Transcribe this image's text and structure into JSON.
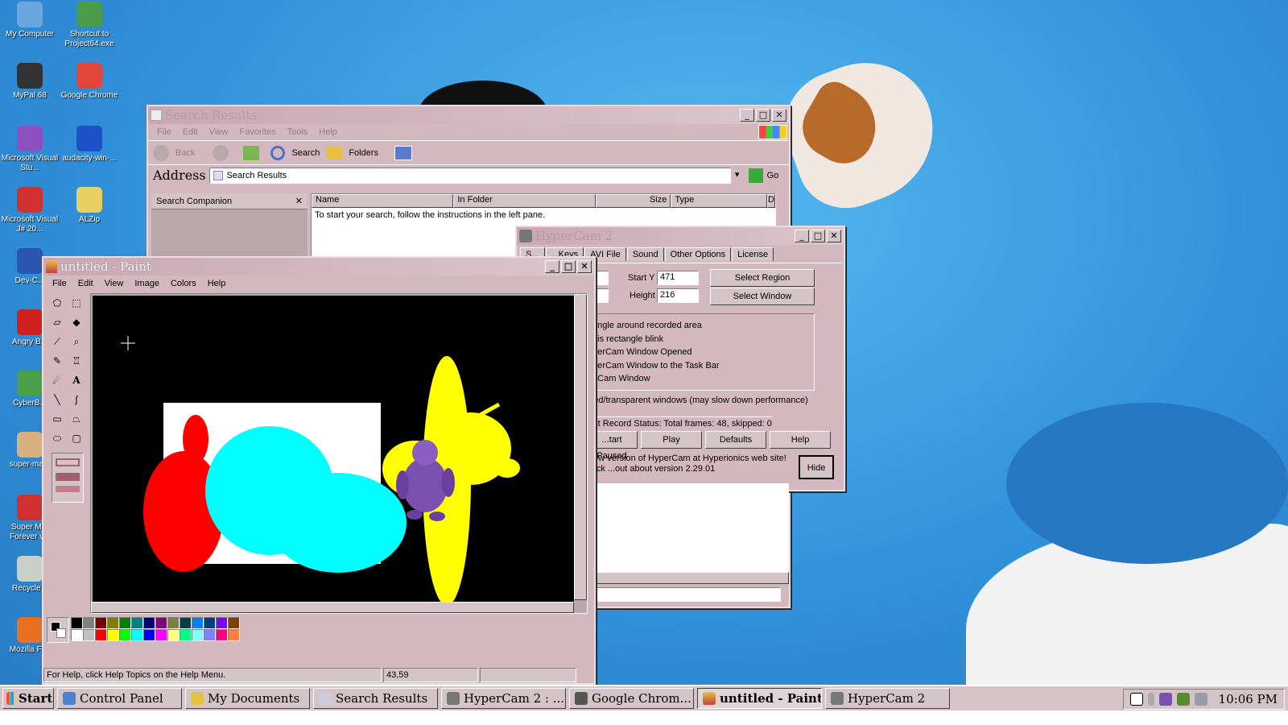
{
  "desktop": {
    "icons": [
      {
        "label": "My Computer",
        "color": "#6aa6e0"
      },
      {
        "label": "Shortcut to Project64.exe",
        "color": "#4b9b4b"
      },
      {
        "label": "MyPal 68",
        "color": "#333333"
      },
      {
        "label": "Google Chrome",
        "color": "#e0473a"
      },
      {
        "label": "Microsoft Visual Stu...",
        "color": "#8c4fc0"
      },
      {
        "label": "audacity-win-...",
        "color": "#1e50c8"
      },
      {
        "label": "Microsoft Visual J# 20...",
        "color": "#d03030"
      },
      {
        "label": "ALZip",
        "color": "#e8d060"
      },
      {
        "label": "Dev-C...",
        "color": "#2a56b0"
      },
      {
        "label": "Angry B...",
        "color": "#d02020"
      },
      {
        "label": "CyberB...",
        "color": "#48a048"
      },
      {
        "label": "super-ma...",
        "color": "#d8b080"
      },
      {
        "label": "Super M... Forever v...",
        "color": "#d03030"
      },
      {
        "label": "Recycle...",
        "color": "#c8d0c8"
      },
      {
        "label": "Mozilla Fi...",
        "color": "#e87020"
      }
    ]
  },
  "search_window": {
    "title": "Search Results",
    "menu": [
      "File",
      "Edit",
      "View",
      "Favorites",
      "Tools",
      "Help"
    ],
    "toolbar": {
      "back": "Back",
      "search": "Search",
      "folders": "Folders"
    },
    "address_label": "Address",
    "address_value": "Search Results",
    "go_label": "Go",
    "companion_title": "Search Companion",
    "columns": [
      "Name",
      "In Folder",
      "Size",
      "Type",
      "D"
    ],
    "message": "To start your search, follow the instructions in the left pane."
  },
  "hypercam": {
    "title": "HyperCam 2",
    "tabs": [
      "S...",
      "...Keys",
      "AVI File",
      "Sound",
      "Other Options",
      "License"
    ],
    "start_y_label": "Start Y",
    "start_y_value": "471",
    "height_label": "Height",
    "height_value": "216",
    "select_region": "Select Region",
    "select_window": "Select Window",
    "group_label": "...:",
    "options": [
      "...ngle around recorded area",
      "...is rectangle blink",
      "...erCam Window Opened",
      "...erCam Window to the Task Bar",
      "...Cam Window"
    ],
    "layered_option": "...ed/transparent windows (may slow down performance)",
    "record_status": "...st Record Status: Total frames: 48, skipped: 0",
    "buttons": [
      "...tart Paused",
      "Play",
      "Defaults",
      "Help"
    ],
    "news": "...ew version of HyperCam at Hyperionics web site! Click ...out about version 2.29.01",
    "hide": "Hide"
  },
  "paint": {
    "title": "untitled - Paint",
    "menu": [
      "File",
      "Edit",
      "View",
      "Image",
      "Colors",
      "Help"
    ],
    "status_help": "For Help, click Help Topics on the Help Menu.",
    "status_coords": "43,59",
    "palette_top": [
      "#000000",
      "#808080",
      "#800000",
      "#808000",
      "#008000",
      "#008080",
      "#000080",
      "#800080",
      "#808040",
      "#004040",
      "#0080ff",
      "#004080",
      "#8000ff",
      "#804000"
    ],
    "palette_bottom": [
      "#ffffff",
      "#c0c0c0",
      "#ff0000",
      "#ffff00",
      "#00ff00",
      "#00ffff",
      "#0000ff",
      "#ff00ff",
      "#ffff80",
      "#00ff80",
      "#80ffff",
      "#8080ff",
      "#ff0080",
      "#ff8040"
    ]
  },
  "taskbar": {
    "start": "Start",
    "items": [
      "Control Panel",
      "My Documents",
      "Search Results",
      "HyperCam 2 : ...",
      "Google Chrom...",
      "untitled - Paint",
      "HyperCam 2"
    ],
    "active_item": "untitled - Paint",
    "clock": "10:06 PM"
  },
  "colors": {
    "window_face": "#d4b8c0",
    "title_active": "#c9a7b3",
    "canvas_bg": "#000000"
  }
}
